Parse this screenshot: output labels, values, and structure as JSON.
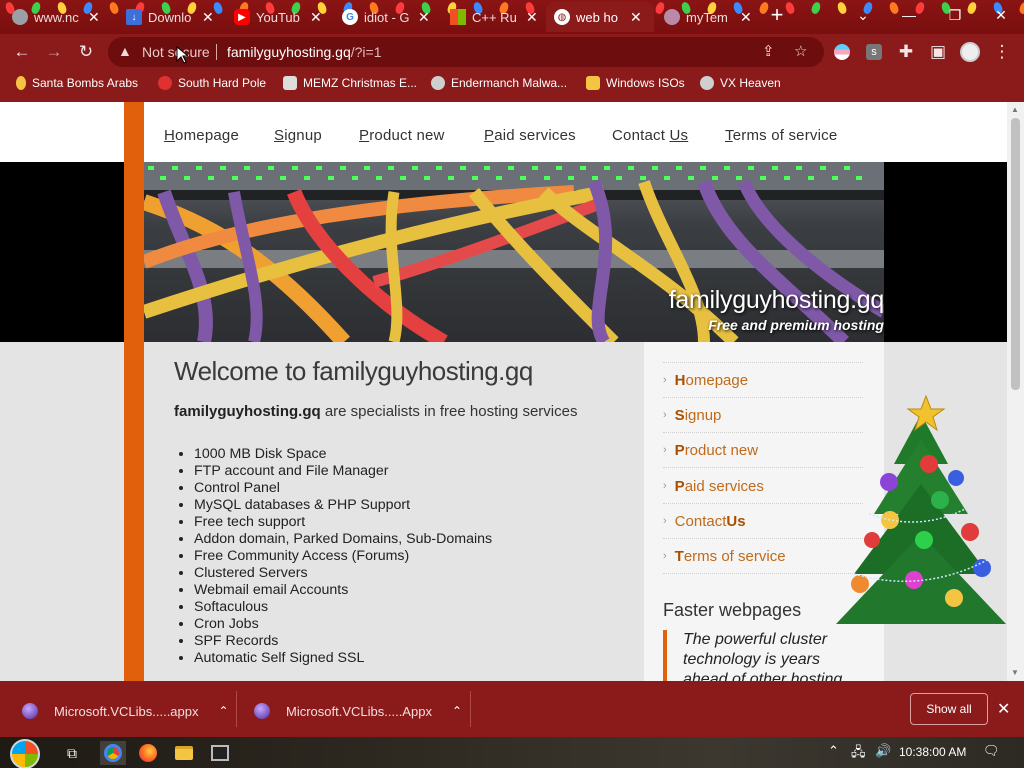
{
  "browser": {
    "tabs": [
      {
        "title": "www.nc",
        "favicon": "chrome-icon",
        "color": "#9aa0a6"
      },
      {
        "title": "Downlo",
        "favicon": "download-icon",
        "color": "#3d6fd8"
      },
      {
        "title": "YouTub",
        "favicon": "youtube-icon",
        "color": "#ff0000"
      },
      {
        "title": "idiot - G",
        "favicon": "google-icon",
        "color": "#ffffff"
      },
      {
        "title": "C++ Ru",
        "favicon": "microsoft-icon",
        "color": "#7fba00"
      },
      {
        "title": "web ho",
        "favicon": "globe-icon",
        "color": "#ffffff",
        "active": true
      },
      {
        "title": "myTem",
        "favicon": "fingerprint-icon",
        "color": "#b98aa8"
      }
    ],
    "new_tab_icon": "plus-icon",
    "window_controls": [
      "chevron-down-icon",
      "minimize-icon",
      "restore-icon",
      "close-icon"
    ],
    "omnibox": {
      "security": "Not secure",
      "host": "familyguyhosting.gq",
      "path": "/?i=1"
    },
    "bookmarks": [
      {
        "label": "Santa Bombs Arabs",
        "color": "#f4c542"
      },
      {
        "label": "South Hard Pole",
        "color": "#e03131"
      },
      {
        "label": "MEMZ Christmas E...",
        "color": "#dddddd"
      },
      {
        "label": "Endermanch Malwa...",
        "color": "#cfcfcf"
      },
      {
        "label": "Windows ISOs",
        "color": "#f4c542"
      },
      {
        "label": "VX Heaven",
        "color": "#cfcfcf"
      }
    ]
  },
  "site": {
    "nav": [
      {
        "first": "H",
        "rest": "omepage"
      },
      {
        "first": "S",
        "rest": "ignup"
      },
      {
        "first": "P",
        "rest": "roduct new"
      },
      {
        "first": "P",
        "rest": "aid services"
      },
      {
        "first": "Contact ",
        "rest": "Us",
        "underline_last": true
      },
      {
        "first": "T",
        "rest": "erms of service"
      }
    ],
    "title": "familyguyhosting.gq",
    "subtitle": "Free and premium hosting",
    "welcome": "Welcome to familyguyhosting.gq",
    "intro_bold": "familyguyhosting.gq",
    "intro_rest": " are specialists in free hosting services",
    "features": [
      "1000 MB Disk Space",
      "FTP account and File Manager",
      "Control Panel",
      "MySQL databases & PHP Support",
      "Free tech support",
      "Addon domain, Parked Domains, Sub-Domains",
      "Free Community Access (Forums)",
      "Clustered Servers",
      "Webmail email Accounts",
      "Softaculous",
      "Cron Jobs",
      "SPF Records",
      "Automatic Self Signed SSL"
    ],
    "sidebar": [
      {
        "first": "H",
        "rest": "omepage"
      },
      {
        "first": "S",
        "rest": "ignup"
      },
      {
        "first": "P",
        "rest": "roduct new"
      },
      {
        "first": "P",
        "rest": "aid services"
      },
      {
        "first": "Contact ",
        "rest": "Us"
      },
      {
        "first": "T",
        "rest": "erms of service"
      }
    ],
    "faster_title": "Faster webpages",
    "quote": "The powerful cluster technology is years ahead of other hosting"
  },
  "downloads": [
    {
      "name": "Microsoft.VCLibs.....appx"
    },
    {
      "name": "Microsoft.VCLibs.....Appx"
    }
  ],
  "show_all": "Show all",
  "taskbar": {
    "clock": "10:38:00 AM"
  },
  "colors": {
    "accent_orange": "#e0600c",
    "chrome_red": "#8b1a1a",
    "link_brown": "#c06a1a"
  }
}
